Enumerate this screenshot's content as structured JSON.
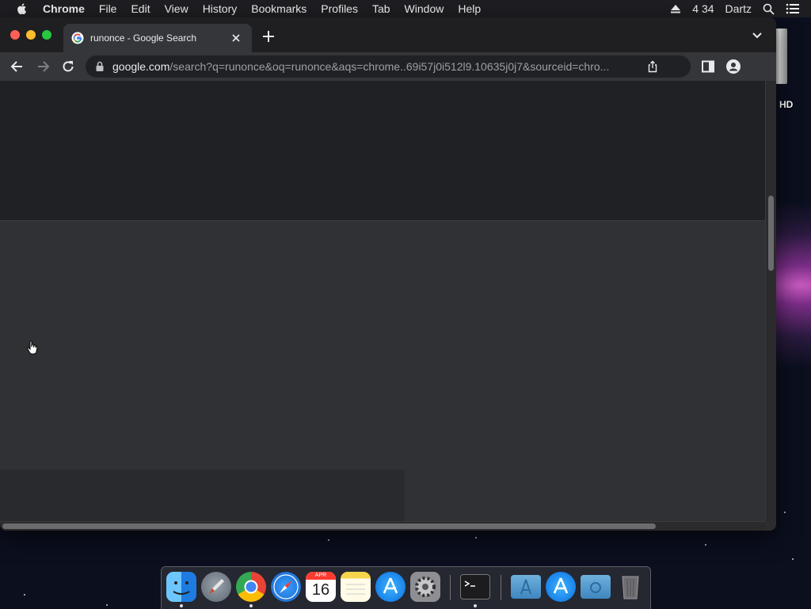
{
  "menubar": {
    "app_name": "Chrome",
    "items": [
      "File",
      "Edit",
      "View",
      "History",
      "Bookmarks",
      "Profiles",
      "Tab",
      "Window",
      "Help"
    ],
    "clock": "4 34",
    "user": "Dartz"
  },
  "desktop": {
    "volume_label": "HD"
  },
  "browser": {
    "tab": {
      "title": "runonce - Google Search"
    },
    "address_bar": {
      "host": "google.com",
      "path": "/search?q=runonce&oq=runonce&aqs=chrome..69i57j0i512l9.10635j0j7&sourceid=chro..."
    }
  },
  "dock": {
    "calendar_month": "APR",
    "calendar_day": "16",
    "items": [
      "Finder",
      "Launchpad",
      "Chrome",
      "Safari",
      "Calendar",
      "Notes",
      "App Store",
      "System Preferences",
      "Terminal",
      "Applications",
      "App Store Downloads",
      "Downloads",
      "Trash"
    ]
  },
  "colors": {
    "window_bg": "#2d2d2f",
    "tab_active": "#35363a",
    "omnibox_bg": "#202124"
  }
}
